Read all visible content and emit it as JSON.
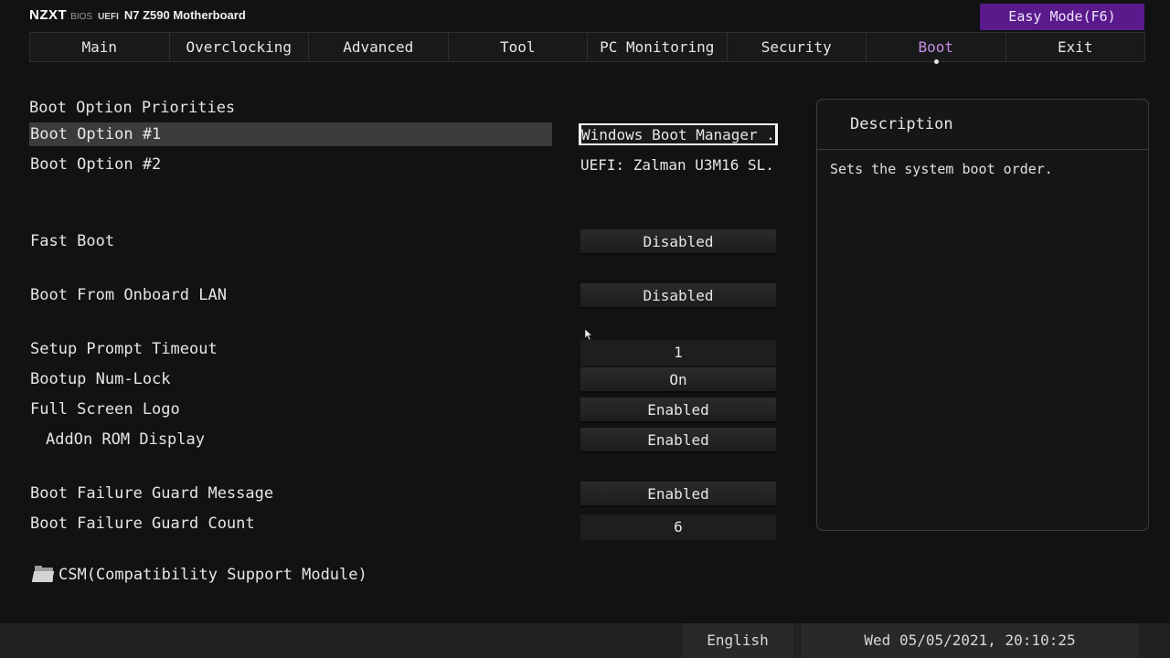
{
  "header": {
    "logo": "NZXT",
    "bios": "BIOS",
    "uefi": "UEFI",
    "model": "N7 Z590 Motherboard",
    "easy_mode": "Easy Mode(F6)"
  },
  "tabs": [
    {
      "label": "Main"
    },
    {
      "label": "Overclocking"
    },
    {
      "label": "Advanced"
    },
    {
      "label": "Tool"
    },
    {
      "label": "PC Monitoring"
    },
    {
      "label": "Security"
    },
    {
      "label": "Boot",
      "active": true
    },
    {
      "label": "Exit"
    }
  ],
  "accent_color": "#c58be8",
  "easy_mode_color": "#5a1a8c",
  "settings": {
    "section_title": "Boot Option Priorities",
    "boot_option_1": {
      "label": "Boot Option #1",
      "value": "Windows Boot Manager ..."
    },
    "boot_option_2": {
      "label": "Boot Option #2",
      "value": "UEFI: Zalman U3M16 SL..."
    },
    "fast_boot": {
      "label": "Fast Boot",
      "value": "Disabled"
    },
    "boot_lan": {
      "label": "Boot From Onboard LAN",
      "value": "Disabled"
    },
    "setup_timeout": {
      "label": "Setup Prompt Timeout",
      "value": "1"
    },
    "num_lock": {
      "label": "Bootup Num-Lock",
      "value": "On"
    },
    "full_logo": {
      "label": "Full Screen Logo",
      "value": "Enabled"
    },
    "addon_rom": {
      "label": "AddOn ROM Display",
      "value": "Enabled"
    },
    "guard_msg": {
      "label": "Boot Failure Guard Message",
      "value": "Enabled"
    },
    "guard_count": {
      "label": "Boot Failure Guard Count",
      "value": "6"
    },
    "csm": {
      "label": "CSM(Compatibility Support Module)",
      "icon": "folder-icon"
    }
  },
  "description": {
    "title": "Description",
    "text": "Sets the system boot order."
  },
  "footer": {
    "language": "English",
    "datetime": "Wed 05/05/2021, 20:10:25"
  }
}
